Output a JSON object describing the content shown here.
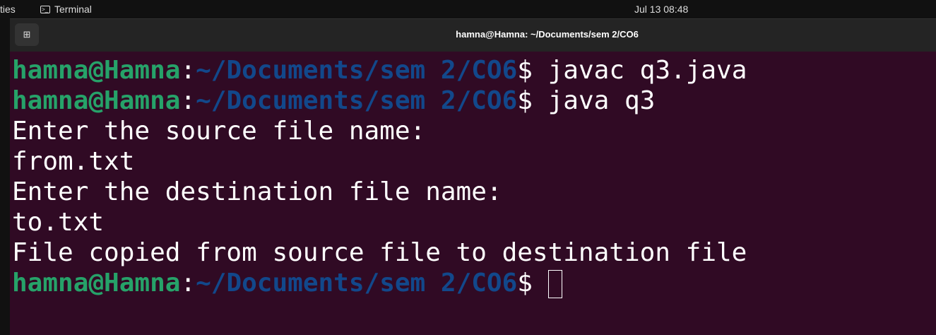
{
  "topbar": {
    "activities": "ties",
    "app": "Terminal",
    "clock": "Jul 13  08:48"
  },
  "window": {
    "title": "hamna@Hamna: ~/Documents/sem 2/CO6"
  },
  "prompt": {
    "user": "hamna@Hamna",
    "sep": ":",
    "path": "~/Documents/sem 2/CO6",
    "dollar": "$ "
  },
  "lines": {
    "cmd1": "javac q3.java",
    "cmd2": "java q3",
    "out1": "Enter the source file name:",
    "in1": "from.txt",
    "out2": "Enter the destination file name:",
    "in2": "to.txt",
    "out3": "File copied from source file to destination file"
  }
}
